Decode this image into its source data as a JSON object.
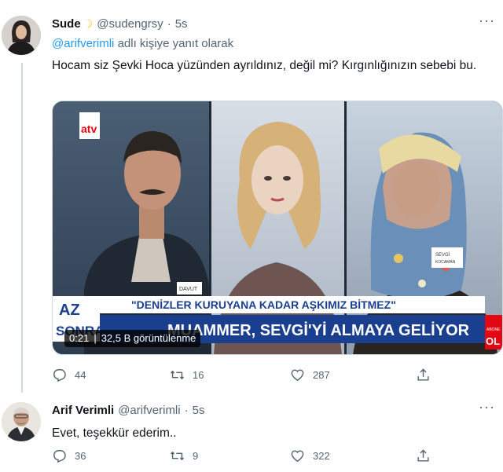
{
  "tweets": [
    {
      "display_name": "Sude",
      "handle": "@sudengrsy",
      "separator": "·",
      "time": "5s",
      "reply_mention": "@arifverimli",
      "reply_suffix": "adlı kişiye yanıt olarak",
      "text": "Hocam siz Şevki Hoca yüzünden ayrıldınız, değil mi? Kırgınlığınızın sebebi bu.",
      "media": {
        "channel_logo": "atv",
        "duration": "0:21",
        "views": "32,5 B görüntülenme",
        "lower_third_headline": "\"DENİZLER KURUYANA KADAR AŞKIMIZ BİTMEZ\"",
        "banner_text": "MUAMMER, SEVGİ'Yİ ALMAYA GELİYOR",
        "side_tag_line1": "AZ",
        "side_tag_line2": "SONRA",
        "corner_small": "ABONE",
        "corner_big": "OL",
        "name_plate_left": "DAVUT",
        "name_plate_right_line1": "SEVGİ",
        "name_plate_right_line2": "KOCAMAN"
      },
      "replies": "44",
      "retweets": "16",
      "likes": "287"
    },
    {
      "display_name": "Arif Verimli",
      "handle": "@arifverimli",
      "separator": "·",
      "time": "5s",
      "text": "Evet, teşekkür ederim..",
      "replies": "36",
      "retweets": "9",
      "likes": "322"
    }
  ],
  "more_glyph": "···",
  "icons": {
    "reply": "reply-icon",
    "retweet": "retweet-icon",
    "like": "heart-icon",
    "share": "share-icon",
    "moon": "crescent-moon-emoji"
  },
  "colors": {
    "accent": "#1d9bf0",
    "muted": "#536471",
    "text": "#0f1419",
    "banner_blue": "#1b3f8f"
  }
}
